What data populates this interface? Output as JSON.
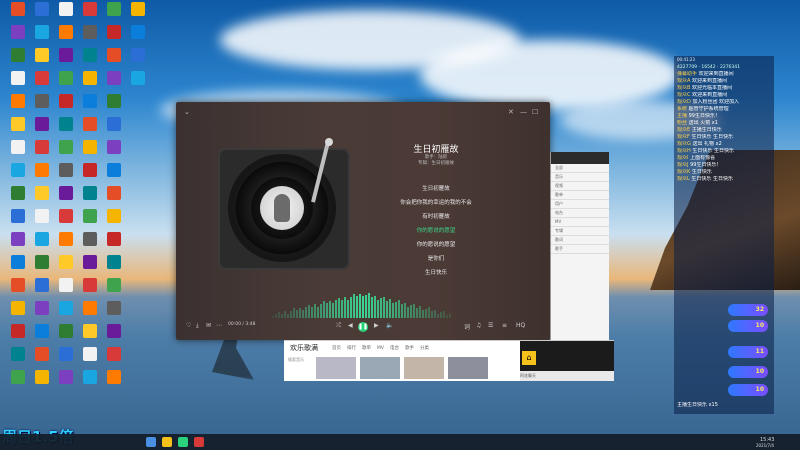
{
  "desktop": {
    "overlay_text": "周日1.5倍",
    "icon_colors": [
      "#e44d26",
      "#2b6fd6",
      "#f2f2f2",
      "#d83a3a",
      "#3fa34d",
      "#f4b400",
      "#7b3fbf",
      "#1aa6e0",
      "#ff7a00",
      "#5d5d5d",
      "#c62828",
      "#0b7dda",
      "#2e7d32",
      "#ffca28",
      "#6a1b9a",
      "#00838f"
    ]
  },
  "player": {
    "song_title": "生日初雁故",
    "song_meta": [
      "歌手：陆新",
      "专辑：生日初雁故"
    ],
    "lyrics": [
      {
        "text": "生日初雁故",
        "active": false
      },
      {
        "text": "你会把你我的幸运的我的不会",
        "active": false
      },
      {
        "text": "有时初雁故",
        "active": false
      },
      {
        "text": "你的愿说的愿望",
        "active": true
      },
      {
        "text": "你的愿说的愿望",
        "active": false
      },
      {
        "text": "是你们",
        "active": false
      },
      {
        "text": "生日快乐",
        "active": false
      }
    ],
    "time": "00:00 / 3:48",
    "accent": "#2ad27b"
  },
  "browser": {
    "brand": "欢乐歌满",
    "tabs": [
      "首页",
      "排行",
      "歌单",
      "MV",
      "电台",
      "歌手",
      "分类"
    ],
    "search_hint": "搜索音乐",
    "status": "阿花聊天"
  },
  "side_window": {
    "rows": [
      "全部",
      "音乐",
      "视频",
      "歌单",
      "用户",
      "电台",
      "MV",
      "专辑",
      "歌词",
      "歌手"
    ]
  },
  "chat": {
    "header": "00:41:23",
    "stats": [
      "4227709",
      "16542",
      "2276341"
    ],
    "messages": [
      {
        "name": "弹幕助手",
        "text": "欢迎来到直播间"
      },
      {
        "name": "观众A",
        "text": "欢迎来到直播间"
      },
      {
        "name": "观众B",
        "text": "欢迎光临本直播间"
      },
      {
        "name": "观众C",
        "text": "欢迎来到直播间"
      },
      {
        "name": "观众D",
        "text": "加入粉丝团 欢迎加入"
      },
      {
        "name": "系统",
        "text": "超管守护系统管理"
      },
      {
        "name": "主播",
        "text": "99生日快乐！"
      },
      {
        "name": "粉丝",
        "text": "送出 火箭 x1"
      },
      {
        "name": "观众E",
        "text": "主播生日快乐"
      },
      {
        "name": "观众F",
        "text": "生日快乐 生日快乐"
      },
      {
        "name": "观众G",
        "text": "送出 礼物 x2"
      },
      {
        "name": "观众H",
        "text": "生日快乐 生日快乐"
      },
      {
        "name": "观众I",
        "text": "上面有惊喜"
      },
      {
        "name": "观众J",
        "text": "99生日快乐！"
      },
      {
        "name": "观众K",
        "text": "生日快乐"
      },
      {
        "name": "观众L",
        "text": "生日快乐 生日快乐"
      }
    ],
    "gifts": [
      "32",
      "10",
      "11",
      "10",
      "10"
    ],
    "footer": "主播生日快乐 x15"
  },
  "taskbar": {
    "time": "15:43",
    "date": "2021/7/4"
  }
}
